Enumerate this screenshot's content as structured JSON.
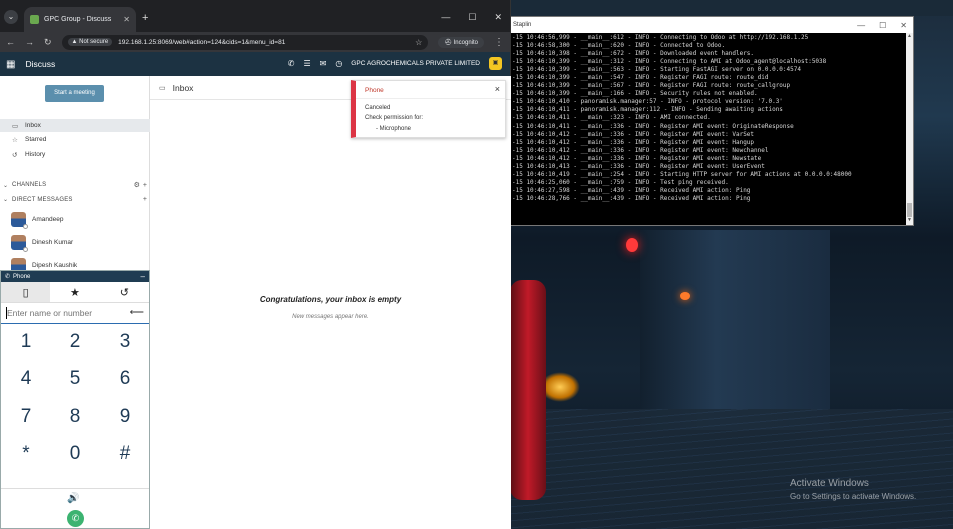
{
  "browser": {
    "tab_title": "GPC Group - Discuss",
    "tab_close": "✕",
    "new_tab": "+",
    "url": "192.168.1.25:8069/web#action=124&cids=1&menu_id=81",
    "security_label": "Not secure",
    "incognito_label": "Incognito"
  },
  "odoo": {
    "app_name": "Discuss",
    "company": "GPC AGROCHEMICALS PRIVATE LIMITED"
  },
  "sidebar": {
    "meeting_button": "Start a meeting",
    "items": [
      {
        "label": "Inbox",
        "icon": "inbox-icon"
      },
      {
        "label": "Starred",
        "icon": "star-icon"
      },
      {
        "label": "History",
        "icon": "history-icon"
      }
    ],
    "channels_label": "CHANNELS",
    "dm_label": "DIRECT MESSAGES",
    "direct_messages": [
      "Amandeep",
      "Dinesh Kumar",
      "Dipesh Kaushik"
    ]
  },
  "main": {
    "header_title": "Inbox",
    "empty_title": "Congratulations, your inbox is empty",
    "empty_subtitle": "New messages appear here."
  },
  "notification": {
    "title": "Phone",
    "line1": "Canceled",
    "line2": "Check permission for:",
    "line3": "- Microphone"
  },
  "phone": {
    "title": "Phone",
    "input_placeholder": "Enter name or number",
    "keys": [
      "1",
      "2",
      "3",
      "4",
      "5",
      "6",
      "7",
      "8",
      "9",
      "*",
      "0",
      "#"
    ]
  },
  "terminal": {
    "title": "Staplin",
    "lines": [
      "-15 10:46:56,999 - __main__:612 - INFO - Connecting to Odoo at http://192.168.1.25",
      "-15 10:46:58,300 - __main__:620 - INFO - Connected to Odoo.",
      "-15 10:46:10,398 - __main__:672 - INFO - Downloaded event handlers.",
      "-15 10:46:10,399 - __main__:312 - INFO - Connecting to AMI at Odoo_agent@localhost:5038",
      "-15 10:46:10,399 - __main__:563 - INFO - Starting FastAGI server on 0.0.0.0:4574",
      "-15 10:46:10,399 - __main__:547 - INFO - Register FAGI route: route_did",
      "-15 10:46:10,399 - __main__:567 - INFO - Register FAGI route: route_callgroup",
      "-15 10:46:10,399 - __main__:166 - INFO - Security rules not enabled.",
      "-15 10:46:10,410 - panoramisk.manager:57 - INFO - protocol version: '7.0.3'",
      "-15 10:46:10,411 - panoramisk.manager:112 - INFO - Sending awaiting actions",
      "-15 10:46:10,411 - __main__:323 - INFO - AMI connected.",
      "-15 10:46:10,411 - __main__:336 - INFO - Register AMI event: OriginateResponse",
      "-15 10:46:10,412 - __main__:336 - INFO - Register AMI event: VarSet",
      "-15 10:46:10,412 - __main__:336 - INFO - Register AMI event: Hangup",
      "-15 10:46:10,412 - __main__:336 - INFO - Register AMI event: Newchannel",
      "-15 10:46:10,412 - __main__:336 - INFO - Register AMI event: Newstate",
      "-15 10:46:10,413 - __main__:336 - INFO - Register AMI event: UserEvent",
      "-15 10:46:10,419 - __main__:254 - INFO - Starting HTTP server for AMI actions at 0.0.0.0:48000",
      "-15 10:46:25,060 - __main__:759 - INFO - Test ping received.",
      "-15 10:46:27,598 - __main__:439 - INFO - Received AMI action: Ping",
      "-15 10:46:28,766 - __main__:439 - INFO - Received AMI action: Ping"
    ]
  },
  "desktop": {
    "activate_title": "Activate Windows",
    "activate_sub": "Go to Settings to activate Windows."
  },
  "colors": {
    "odoo_nav": "#1c3242",
    "meeting_button": "#5b8fad",
    "notification_border": "#dc3545",
    "call_button": "#3cb371"
  }
}
